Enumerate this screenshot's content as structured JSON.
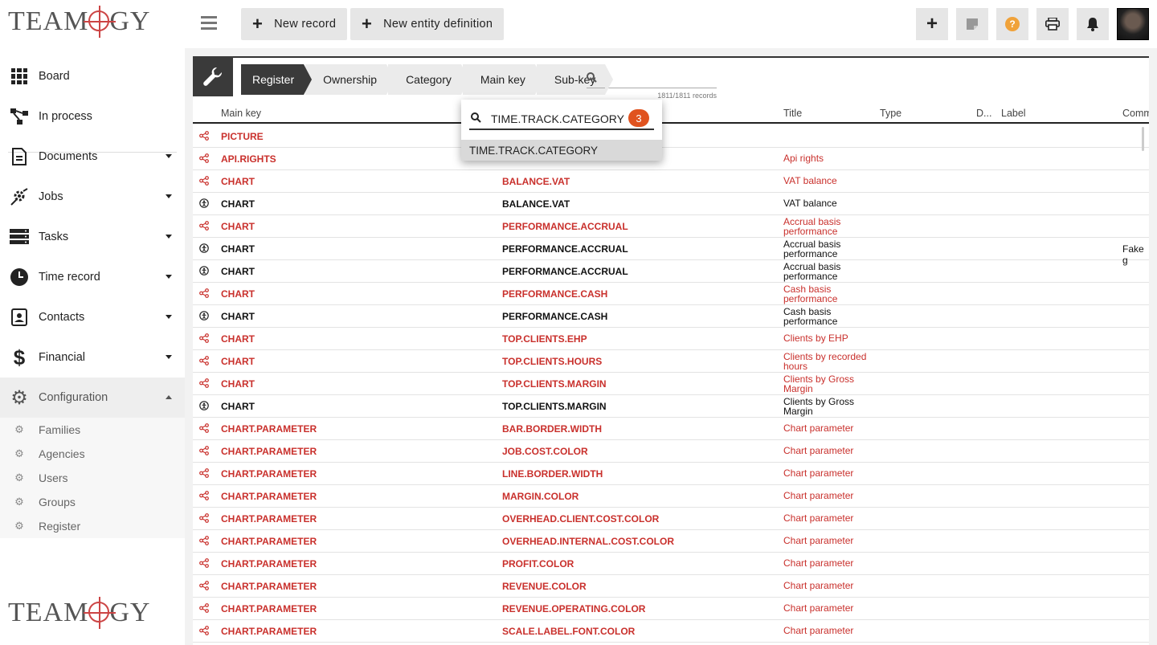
{
  "brand": {
    "name": "TEAMOGY",
    "letters_left": "TEAM",
    "letters_right": "GY"
  },
  "sidebar": {
    "items": [
      {
        "label": "Board"
      },
      {
        "label": "In process"
      },
      {
        "label": "Documents"
      },
      {
        "label": "Jobs"
      },
      {
        "label": "Tasks"
      },
      {
        "label": "Time record"
      },
      {
        "label": "Contacts"
      },
      {
        "label": "Financial"
      },
      {
        "label": "Configuration"
      }
    ],
    "config_sub": [
      {
        "label": "Families"
      },
      {
        "label": "Agencies"
      },
      {
        "label": "Users"
      },
      {
        "label": "Groups"
      },
      {
        "label": "Register"
      }
    ]
  },
  "toolbar": {
    "new_record": "New record",
    "new_entity": "New entity definition"
  },
  "breadcrumb": [
    "Register",
    "Ownership",
    "Category",
    "Main key",
    "Sub-key"
  ],
  "search": {
    "count": "1811/1811 records"
  },
  "columns": {
    "main_key": "Main key",
    "title": "Title",
    "type": "Type",
    "d": "D...",
    "label": "Label",
    "comment": "Comm"
  },
  "popup": {
    "value": "TIME.TRACK.CATEGORY",
    "badge": "3",
    "option": "TIME.TRACK.CATEGORY"
  },
  "rows": [
    {
      "own": "share",
      "main": "PICTURE",
      "sub": "",
      "title": "",
      "comment": ""
    },
    {
      "own": "share",
      "main": "API.RIGHTS",
      "sub": "",
      "title": "Api rights",
      "comment": ""
    },
    {
      "own": "share",
      "main": "CHART",
      "sub": "BALANCE.VAT",
      "title": "VAT balance",
      "comment": ""
    },
    {
      "own": "owner",
      "main": "CHART",
      "sub": "BALANCE.VAT",
      "title": "VAT balance",
      "comment": ""
    },
    {
      "own": "share",
      "main": "CHART",
      "sub": "PERFORMANCE.ACCRUAL",
      "title": "Accrual basis performance",
      "comment": ""
    },
    {
      "own": "owner",
      "main": "CHART",
      "sub": "PERFORMANCE.ACCRUAL",
      "title": "Accrual basis performance",
      "comment": "Fake g"
    },
    {
      "own": "owner",
      "main": "CHART",
      "sub": "PERFORMANCE.ACCRUAL",
      "title": "Accrual basis performance",
      "comment": ""
    },
    {
      "own": "share",
      "main": "CHART",
      "sub": "PERFORMANCE.CASH",
      "title": "Cash basis performance",
      "comment": ""
    },
    {
      "own": "owner",
      "main": "CHART",
      "sub": "PERFORMANCE.CASH",
      "title": "Cash basis performance",
      "comment": ""
    },
    {
      "own": "share",
      "main": "CHART",
      "sub": "TOP.CLIENTS.EHP",
      "title": "Clients by EHP",
      "comment": ""
    },
    {
      "own": "share",
      "main": "CHART",
      "sub": "TOP.CLIENTS.HOURS",
      "title": "Clients by recorded hours",
      "comment": ""
    },
    {
      "own": "share",
      "main": "CHART",
      "sub": "TOP.CLIENTS.MARGIN",
      "title": "Clients by Gross Margin",
      "comment": ""
    },
    {
      "own": "owner",
      "main": "CHART",
      "sub": "TOP.CLIENTS.MARGIN",
      "title": "Clients by Gross Margin",
      "comment": ""
    },
    {
      "own": "share",
      "main": "CHART.PARAMETER",
      "sub": "BAR.BORDER.WIDTH",
      "title": "Chart parameter",
      "comment": ""
    },
    {
      "own": "share",
      "main": "CHART.PARAMETER",
      "sub": "JOB.COST.COLOR",
      "title": "Chart parameter",
      "comment": ""
    },
    {
      "own": "share",
      "main": "CHART.PARAMETER",
      "sub": "LINE.BORDER.WIDTH",
      "title": "Chart parameter",
      "comment": ""
    },
    {
      "own": "share",
      "main": "CHART.PARAMETER",
      "sub": "MARGIN.COLOR",
      "title": "Chart parameter",
      "comment": ""
    },
    {
      "own": "share",
      "main": "CHART.PARAMETER",
      "sub": "OVERHEAD.CLIENT.COST.COLOR",
      "title": "Chart parameter",
      "comment": ""
    },
    {
      "own": "share",
      "main": "CHART.PARAMETER",
      "sub": "OVERHEAD.INTERNAL.COST.COLOR",
      "title": "Chart parameter",
      "comment": ""
    },
    {
      "own": "share",
      "main": "CHART.PARAMETER",
      "sub": "PROFIT.COLOR",
      "title": "Chart parameter",
      "comment": ""
    },
    {
      "own": "share",
      "main": "CHART.PARAMETER",
      "sub": "REVENUE.COLOR",
      "title": "Chart parameter",
      "comment": ""
    },
    {
      "own": "share",
      "main": "CHART.PARAMETER",
      "sub": "REVENUE.OPERATING.COLOR",
      "title": "Chart parameter",
      "comment": ""
    },
    {
      "own": "share",
      "main": "CHART.PARAMETER",
      "sub": "SCALE.LABEL.FONT.COLOR",
      "title": "Chart parameter",
      "comment": ""
    }
  ],
  "colors": {
    "accent_red": "#c9302c",
    "badge": "#e0531f",
    "help": "#f0a23a",
    "dark": "#3a3a3a"
  },
  "icons": {
    "share": "share-icon",
    "owner": "owner-icon",
    "board": "grid-icon",
    "in_process": "workflow-icon",
    "documents": "document-icon",
    "jobs": "jobs-icon",
    "tasks": "tasks-icon",
    "time_record": "clock-icon",
    "contacts": "contacts-icon",
    "financial": "dollar-icon",
    "configuration": "gear-icon"
  }
}
